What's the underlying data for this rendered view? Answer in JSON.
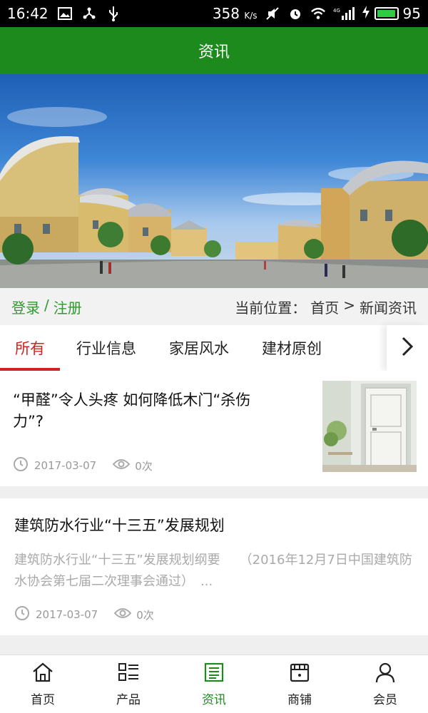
{
  "status_bar": {
    "time": "16:42",
    "net_speed": "358",
    "net_unit": "K/s",
    "network_type": "4G",
    "battery_level": "95",
    "battery_color": "#2ecc40"
  },
  "header": {
    "title": "资讯"
  },
  "location_bar": {
    "login": "登录",
    "separator": "/",
    "register": "注册",
    "current_label": "当前位置：",
    "crumb_home": "首页",
    "crumb_sep": ">",
    "crumb_current": "新闻资讯"
  },
  "tabs": [
    {
      "label": "所有",
      "active": true
    },
    {
      "label": "行业信息"
    },
    {
      "label": "家居风水"
    },
    {
      "label": "建材原创"
    }
  ],
  "news": [
    {
      "title": "“甲醛”令人头疼 如何降低木门“杀伤力”?",
      "date": "2017-03-07",
      "views": "0次"
    },
    {
      "title": "建筑防水行业“十三五”发展规划",
      "summary": "建筑防水行业“十三五”发展规划纲要　　（2016年12月7日中国建筑防水协会第七届二次理事会通过）　...",
      "date": "2017-03-07",
      "views": "0次"
    }
  ],
  "bottom_nav": [
    {
      "label": "首页",
      "icon": "home-icon"
    },
    {
      "label": "产品",
      "icon": "grid-list-icon"
    },
    {
      "label": "资讯",
      "icon": "news-icon",
      "active": true
    },
    {
      "label": "商铺",
      "icon": "store-icon"
    },
    {
      "label": "会员",
      "icon": "user-icon"
    }
  ],
  "colors": {
    "brand_green": "#1d8a1d",
    "link_green": "#2e9a2e",
    "active_red": "#d42020"
  }
}
